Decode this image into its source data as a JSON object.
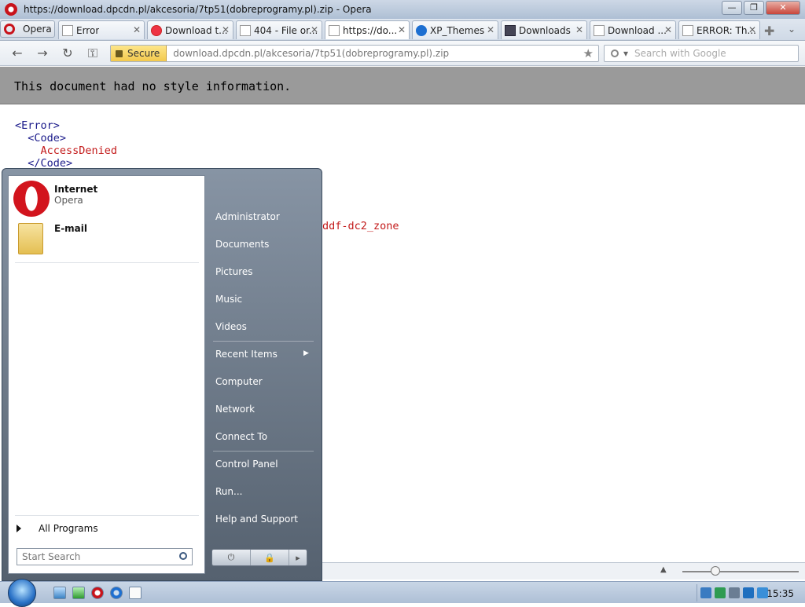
{
  "window": {
    "title": "https://download.dpcdn.pl/akcesoria/7tp51(dobreprogramy.pl).zip - Opera",
    "minimize": "—",
    "maximize": "❐",
    "close": "✕"
  },
  "opera_menu": {
    "label": "Opera"
  },
  "tabs": [
    {
      "label": "Error"
    },
    {
      "label": "Download t..."
    },
    {
      "label": "404 - File or..."
    },
    {
      "label": "https://do..."
    },
    {
      "label": "XP_Themes"
    },
    {
      "label": "Downloads"
    },
    {
      "label": "Download ..."
    },
    {
      "label": "ERROR: Th..."
    }
  ],
  "address_bar": {
    "secure_label": "Secure",
    "url": "download.dpcdn.pl/akcesoria/7tp51(dobreprogramy.pl).zip",
    "search_placeholder": "Search with Google"
  },
  "page": {
    "banner": "This document had no style information.",
    "xml_lines": [
      {
        "tag": "<Error>"
      },
      {
        "tag": "  <Code>"
      },
      {
        "text": "    AccessDenied"
      },
      {
        "tag": "  </Code>"
      }
    ],
    "zone_text": "ddf-dc2_zone"
  },
  "start_menu": {
    "pinned": [
      {
        "title": "Internet",
        "subtitle": "Opera"
      },
      {
        "title": "E-mail",
        "subtitle": ""
      }
    ],
    "all_programs": "All Programs",
    "search_placeholder": "Start Search",
    "right_links": [
      "Administrator",
      "Documents",
      "Pictures",
      "Music",
      "Videos",
      "Recent Items",
      "Computer",
      "Network",
      "Connect To",
      "Control Panel",
      "Run...",
      "Help and Support"
    ]
  },
  "taskbar": {
    "clock": "15:35"
  }
}
